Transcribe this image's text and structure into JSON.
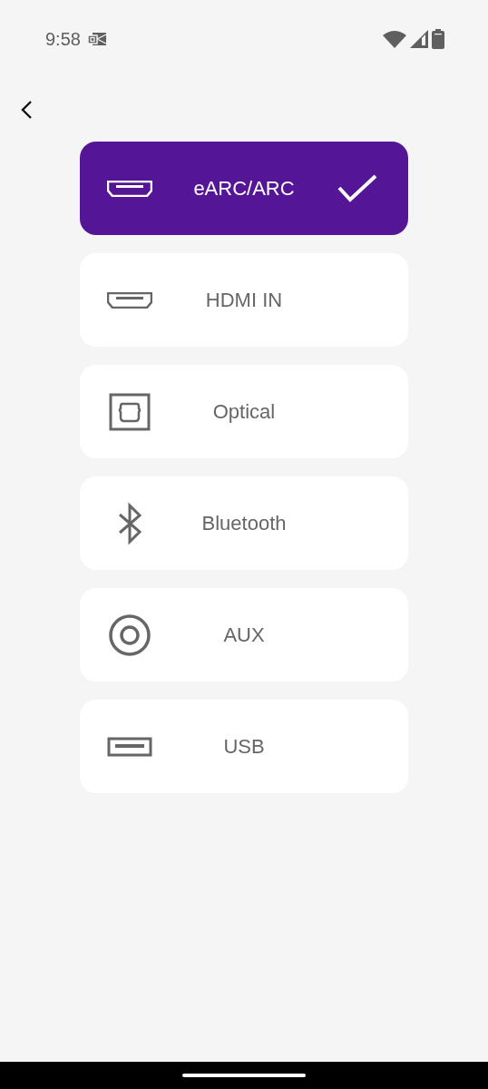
{
  "status_bar": {
    "time": "9:58"
  },
  "inputs": [
    {
      "label": "eARC/ARC",
      "kind": "hdmi",
      "selected": true
    },
    {
      "label": "HDMI IN",
      "kind": "hdmi",
      "selected": false
    },
    {
      "label": "Optical",
      "kind": "optical",
      "selected": false
    },
    {
      "label": "Bluetooth",
      "kind": "bluetooth",
      "selected": false
    },
    {
      "label": "AUX",
      "kind": "aux",
      "selected": false
    },
    {
      "label": "USB",
      "kind": "usb",
      "selected": false
    }
  ]
}
